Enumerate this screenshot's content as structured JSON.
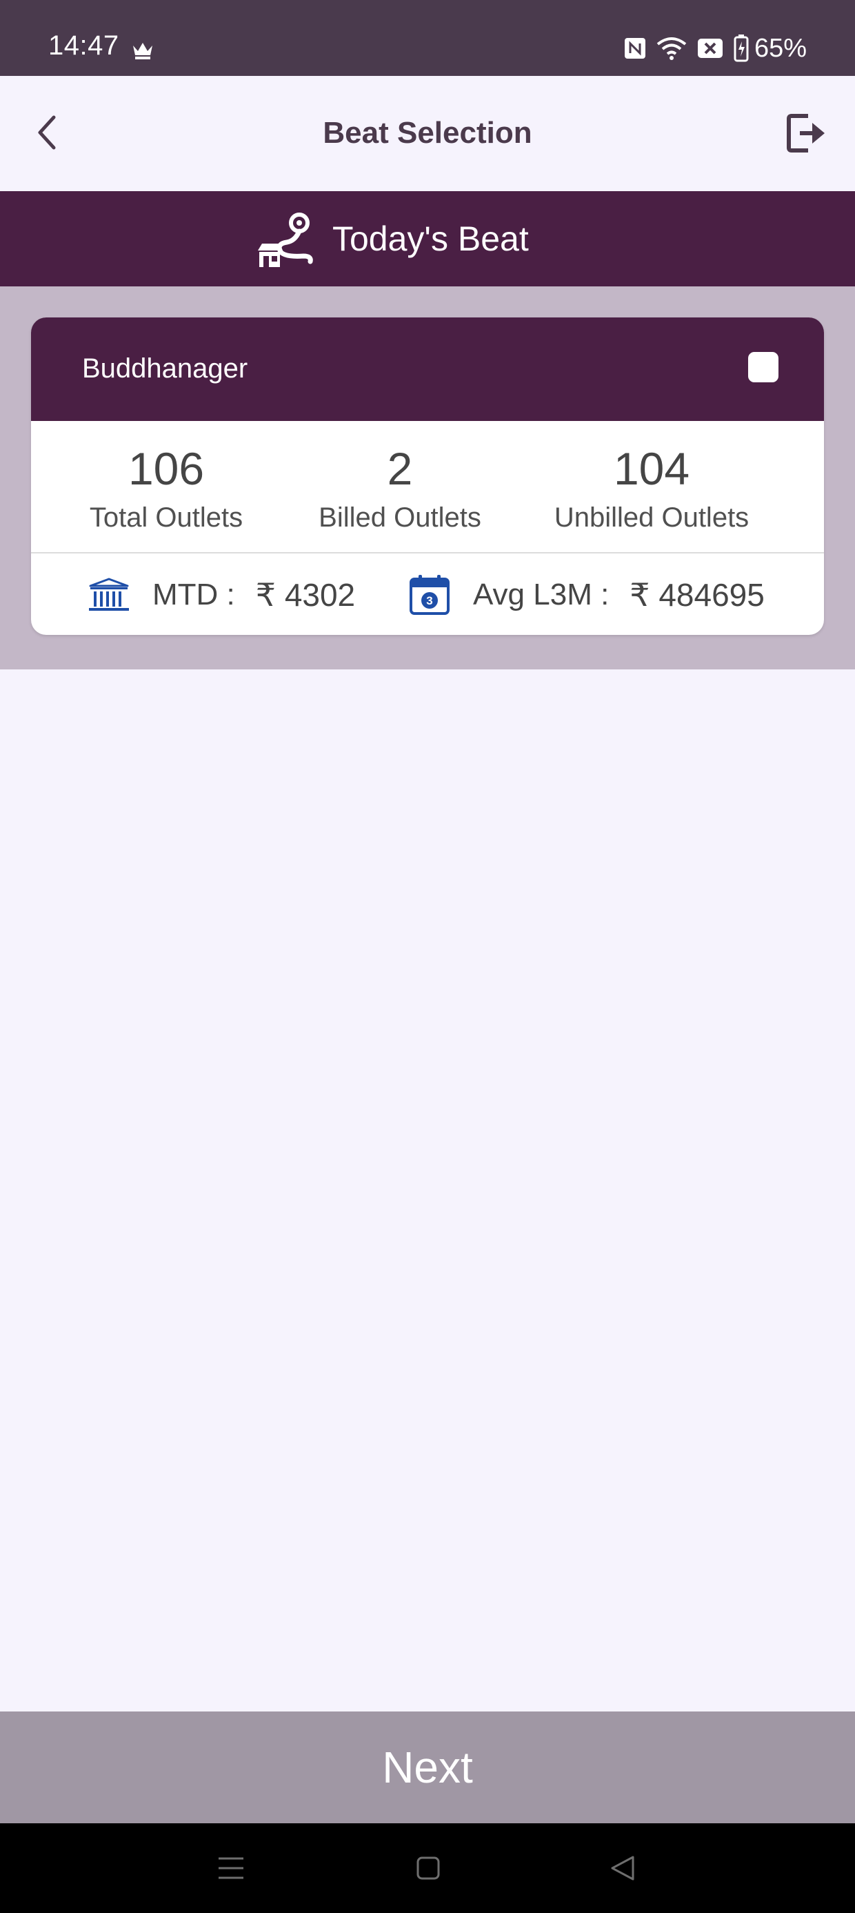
{
  "status_bar": {
    "time": "14:47",
    "battery": "65%",
    "icons": [
      "crown-icon",
      "nfc-icon",
      "wifi-icon",
      "no-sim-icon",
      "battery-icon"
    ]
  },
  "app_bar": {
    "title": "Beat Selection",
    "back_icon": "chevron-left-icon",
    "logout_icon": "logout-icon"
  },
  "banner": {
    "label": "Today's Beat",
    "icon": "route-store-icon"
  },
  "beat_card": {
    "name": "Buddhanager",
    "selected": false,
    "stats": [
      {
        "value": "106",
        "label": "Total Outlets"
      },
      {
        "value": "2",
        "label": "Billed Outlets"
      },
      {
        "value": "104",
        "label": "Unbilled Outlets"
      }
    ],
    "metrics": {
      "mtd": {
        "label": "MTD :",
        "value": "₹ 4302",
        "icon": "bank-icon"
      },
      "avg": {
        "label": "Avg L3M :",
        "value": "₹ 484695",
        "icon": "calendar-icon"
      }
    }
  },
  "footer": {
    "next_label": "Next"
  },
  "colors": {
    "primary": "#4a1f44",
    "status_bar": "#4a3a4d",
    "card_area": "#c3b7c7",
    "next_disabled": "#a097a4",
    "background": "#f6f3fd",
    "icon_blue": "#1f4fa8"
  }
}
